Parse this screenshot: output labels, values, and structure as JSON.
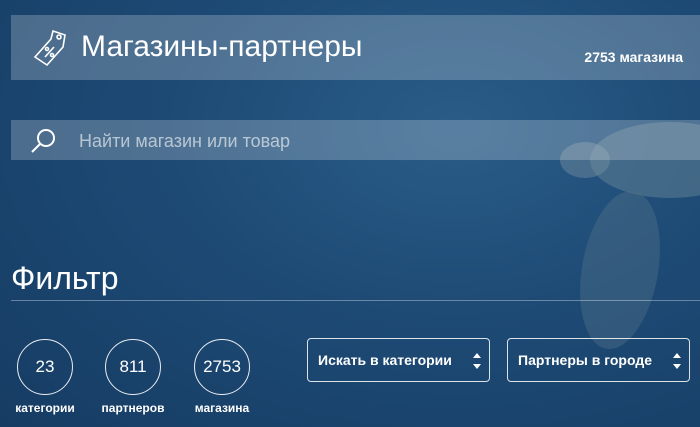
{
  "header": {
    "title": "Магазины-партнеры",
    "store_count": "2753 магазина",
    "icon": "price-tag-icon"
  },
  "search": {
    "placeholder": "Найти магазин или товар",
    "icon": "search-icon"
  },
  "filter": {
    "title": "Фильтр",
    "stats": [
      {
        "value": "23",
        "label": "категории"
      },
      {
        "value": "811",
        "label": "партнеров"
      },
      {
        "value": "2753",
        "label": "магазина"
      }
    ],
    "selects": [
      {
        "label": "Искать в категории"
      },
      {
        "label": "Партнеры в городе"
      }
    ]
  },
  "colors": {
    "background": "#1d4a75",
    "panel": "rgba(255,255,255,0.22)",
    "text": "#ffffff"
  }
}
